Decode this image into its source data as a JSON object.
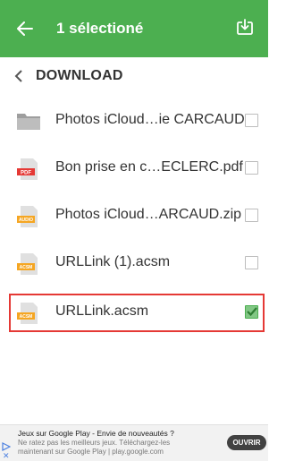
{
  "appbar": {
    "title": "1 sélectioné",
    "color": "#4caf50"
  },
  "path": {
    "label": "DOWNLOAD"
  },
  "files": [
    {
      "name": "Photos iCloud…ie CARCAUD",
      "icon": "folder-icon",
      "checked": false
    },
    {
      "name": "Bon prise en c…ECLERC.pdf",
      "icon": "pdf-file-icon",
      "icon_label": "PDF",
      "checked": false
    },
    {
      "name": "Photos iCloud…ARCAUD.zip",
      "icon": "audio-file-icon",
      "icon_label": "AUDIO",
      "checked": false
    },
    {
      "name": "URLLink (1).acsm",
      "icon": "acsm-file-icon",
      "icon_label": "ACSM",
      "checked": false
    },
    {
      "name": "URLLink.acsm",
      "icon": "acsm-file-icon",
      "icon_label": "ACSM",
      "checked": true
    }
  ],
  "ad": {
    "title": "Jeux sur Google Play - Envie de nouveautés ?",
    "description": "Ne ratez pas les meilleurs jeux. Téléchargez-les maintenant sur Google Play | play.google.com",
    "button": "OUVRIR"
  }
}
